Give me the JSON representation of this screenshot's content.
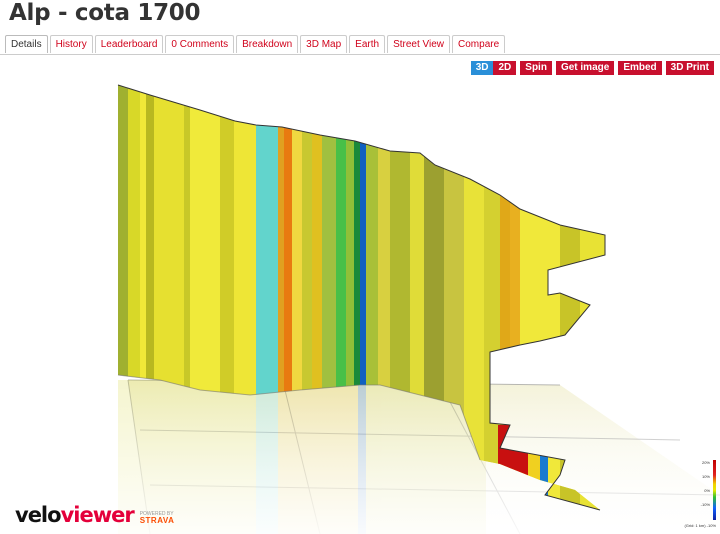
{
  "page": {
    "title": "Alp - cota 1700"
  },
  "tabs": [
    {
      "label": "Details",
      "active": true
    },
    {
      "label": "History",
      "active": false
    },
    {
      "label": "Leaderboard",
      "active": false
    },
    {
      "label": "0 Comments",
      "active": false
    },
    {
      "label": "Breakdown",
      "active": false
    },
    {
      "label": "3D Map",
      "active": false
    },
    {
      "label": "Earth",
      "active": false
    },
    {
      "label": "Street View",
      "active": false
    },
    {
      "label": "Compare",
      "active": false
    }
  ],
  "toolbar": {
    "view_3d": "3D",
    "view_2d": "2D",
    "spin": "Spin",
    "get_image": "Get image",
    "embed": "Embed",
    "print_3d": "3D Print",
    "selected_view": "3D"
  },
  "branding": {
    "logo_part1": "velo",
    "logo_part2": "viewer",
    "powered_by": "POWERED BY",
    "strava": "STRAVA"
  },
  "gradient_legend": {
    "labels": [
      "20%",
      "10%",
      "0%",
      "-10%"
    ],
    "grid_note": "(Grid: 1 km) -10%",
    "colors": [
      "#c00000",
      "#f0d000",
      "#30c030",
      "#1060ff"
    ]
  }
}
